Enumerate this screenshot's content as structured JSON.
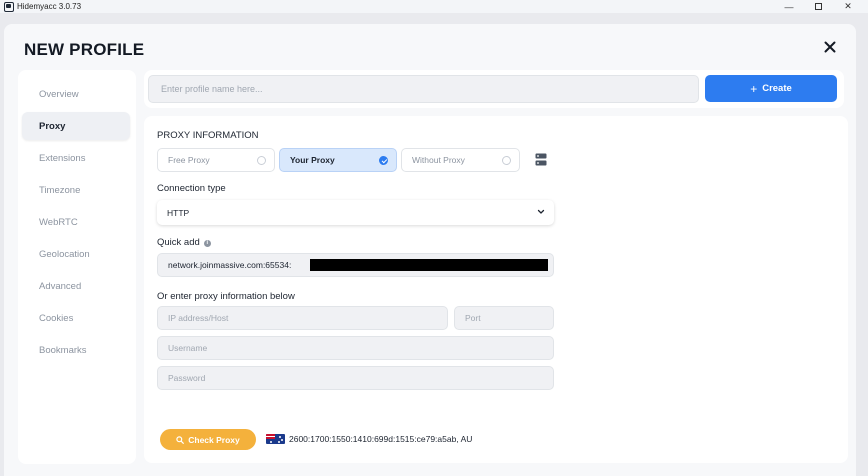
{
  "window": {
    "title": "Hidemyacc 3.0.73",
    "minimize": "—",
    "close": "✕"
  },
  "modal": {
    "title": "NEW PROFILE"
  },
  "sidebar": {
    "items": [
      {
        "label": "Overview",
        "active": false
      },
      {
        "label": "Proxy",
        "active": true
      },
      {
        "label": "Extensions",
        "active": false
      },
      {
        "label": "Timezone",
        "active": false
      },
      {
        "label": "WebRTC",
        "active": false
      },
      {
        "label": "Geolocation",
        "active": false
      },
      {
        "label": "Advanced",
        "active": false
      },
      {
        "label": "Cookies",
        "active": false
      },
      {
        "label": "Bookmarks",
        "active": false
      }
    ]
  },
  "profile": {
    "name_placeholder": "Enter profile name here...",
    "create_label": "Create"
  },
  "proxy": {
    "section_title": "PROXY INFORMATION",
    "options": [
      {
        "label": "Free Proxy",
        "selected": false
      },
      {
        "label": "Your Proxy",
        "selected": true
      },
      {
        "label": "Without Proxy",
        "selected": false
      }
    ],
    "connection_type_label": "Connection type",
    "connection_type_value": "HTTP",
    "quick_add_label": "Quick add",
    "quick_add_value": "network.joinmassive.com:65534:",
    "manual_label": "Or enter proxy information below",
    "host_placeholder": "IP address/Host",
    "port_placeholder": "Port",
    "username_placeholder": "Username",
    "password_placeholder": "Password",
    "check_label": "Check Proxy",
    "result": "2600:1700:1550:1410:699d:1515:ce79:a5ab, AU"
  },
  "colors": {
    "accent": "#2d7cf0",
    "check_button": "#f4b13c",
    "selected_bg": "#d9e8fc"
  },
  "icons": {
    "close": "close-icon",
    "info": "info-icon",
    "server": "server-icon",
    "chevron": "chevron-down-icon",
    "search": "search-icon",
    "flag": "australia-flag-icon"
  }
}
